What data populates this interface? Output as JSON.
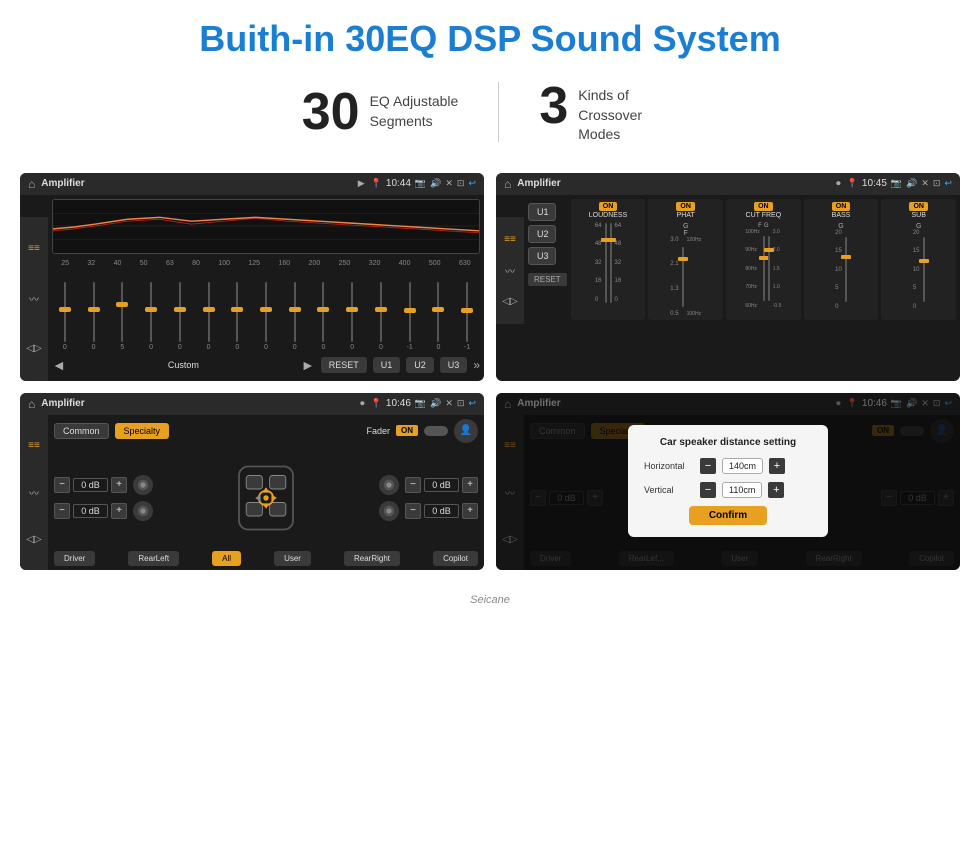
{
  "page": {
    "title": "Buith-in 30EQ DSP Sound System",
    "stat1_number": "30",
    "stat1_label_line1": "EQ Adjustable",
    "stat1_label_line2": "Segments",
    "stat2_number": "3",
    "stat2_label_line1": "Kinds of",
    "stat2_label_line2": "Crossover Modes"
  },
  "screen1": {
    "app_title": "Amplifier",
    "time": "10:44",
    "eq_freqs": [
      "25",
      "32",
      "40",
      "50",
      "63",
      "80",
      "100",
      "125",
      "160",
      "200",
      "250",
      "320",
      "400",
      "500",
      "630"
    ],
    "btn_prev": "◄",
    "btn_label": "Custom",
    "btn_next": "►",
    "btn_reset": "RESET",
    "btn_u1": "U1",
    "btn_u2": "U2",
    "btn_u3": "U3"
  },
  "screen2": {
    "app_title": "Amplifier",
    "time": "10:45",
    "u1": "U1",
    "u2": "U2",
    "u3": "U3",
    "btn_reset": "RESET",
    "cols": [
      {
        "on": "ON",
        "name": "LOUDNESS"
      },
      {
        "on": "ON",
        "name": "PHAT"
      },
      {
        "on": "ON",
        "name": "CUT FREQ"
      },
      {
        "on": "ON",
        "name": "BASS"
      },
      {
        "on": "ON",
        "name": "SUB"
      }
    ]
  },
  "screen3": {
    "app_title": "Amplifier",
    "time": "10:46",
    "btn_common": "Common",
    "btn_specialty": "Specialty",
    "fader_label": "Fader",
    "on_label": "ON",
    "db_values": [
      "0 dB",
      "0 dB",
      "0 dB",
      "0 dB"
    ],
    "btn_driver": "Driver",
    "btn_rearLeft": "RearLeft",
    "btn_all": "All",
    "btn_user": "User",
    "btn_rearRight": "RearRight",
    "btn_copilot": "Copilot"
  },
  "screen4": {
    "app_title": "Amplifier",
    "time": "10:46",
    "btn_common": "Common",
    "btn_specialty": "Specialty",
    "on_label": "ON",
    "db_values": [
      "0 dB",
      "0 dB"
    ],
    "btn_driver": "Driver",
    "btn_rearLeft": "RearLef...",
    "btn_user": "User",
    "btn_rearRight": "RearRight",
    "btn_copilot": "Copilot",
    "dialog": {
      "title": "Car speaker distance setting",
      "horizontal_label": "Horizontal",
      "horizontal_value": "140cm",
      "vertical_label": "Vertical",
      "vertical_value": "110cm",
      "confirm_label": "Confirm"
    }
  },
  "footer": {
    "brand": "Seicane"
  }
}
